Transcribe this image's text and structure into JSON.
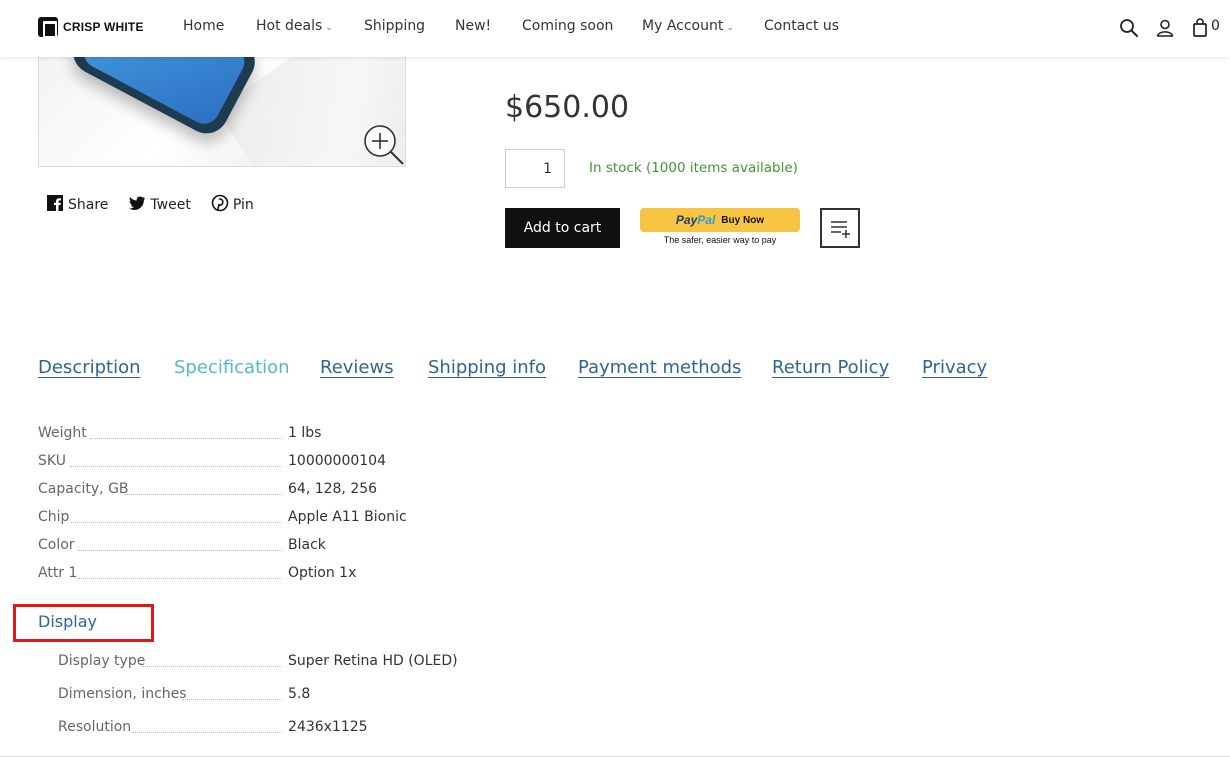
{
  "brand": {
    "name": "CRISP WHITE"
  },
  "nav": {
    "items": [
      {
        "label": "Home",
        "dropdown": false
      },
      {
        "label": "Hot deals",
        "dropdown": true
      },
      {
        "label": "Shipping",
        "dropdown": false
      },
      {
        "label": "New!",
        "dropdown": false
      },
      {
        "label": "Coming soon",
        "dropdown": false
      },
      {
        "label": "My Account",
        "dropdown": true
      },
      {
        "label": "Contact us",
        "dropdown": false
      }
    ],
    "dropdown_glyph": "⌄"
  },
  "header_icons": {
    "search": "search-icon",
    "account": "user-icon",
    "cart": "shopping-bag-icon"
  },
  "cart": {
    "count": "0"
  },
  "share": {
    "share_label": "Share",
    "tweet_label": "Tweet",
    "pin_label": "Pin"
  },
  "product": {
    "price": "$650.00",
    "quantity": "1",
    "stock_text": "In stock (1000 items available)",
    "add_to_cart_label": "Add to cart",
    "paypal": {
      "logo_pay": "Pay",
      "logo_pal": "Pal",
      "button_text": "Buy Now",
      "tagline": "The safer, easier way to pay"
    }
  },
  "tabs": [
    {
      "label": "Description",
      "active": false
    },
    {
      "label": "Specification",
      "active": true
    },
    {
      "label": "Reviews",
      "active": false
    },
    {
      "label": "Shipping info",
      "active": false
    },
    {
      "label": "Payment methods",
      "active": false
    },
    {
      "label": "Return Policy",
      "active": false
    },
    {
      "label": "Privacy",
      "active": false
    }
  ],
  "specs": [
    {
      "label": "Weight",
      "value": "1 lbs"
    },
    {
      "label": "SKU",
      "value": "10000000104"
    },
    {
      "label": "Capacity, GB",
      "value": "64, 128, 256"
    },
    {
      "label": "Chip",
      "value": "Apple A11 Bionic"
    },
    {
      "label": "Color",
      "value": "Black"
    },
    {
      "label": "Attr 1",
      "value": "Option 1x"
    }
  ],
  "display_section": {
    "heading": "Display",
    "specs": [
      {
        "label": "Display type",
        "value": "Super Retina HD (OLED)"
      },
      {
        "label": "Dimension, inches",
        "value": "5.8"
      },
      {
        "label": "Resolution",
        "value": "2436x1125"
      }
    ]
  },
  "colors": {
    "tab_link": "#2f6493",
    "tab_active": "#52b9d3",
    "stock_green": "#3c9a2e",
    "highlight_red": "#e01818",
    "paypal_yellow": "#f7c542"
  }
}
